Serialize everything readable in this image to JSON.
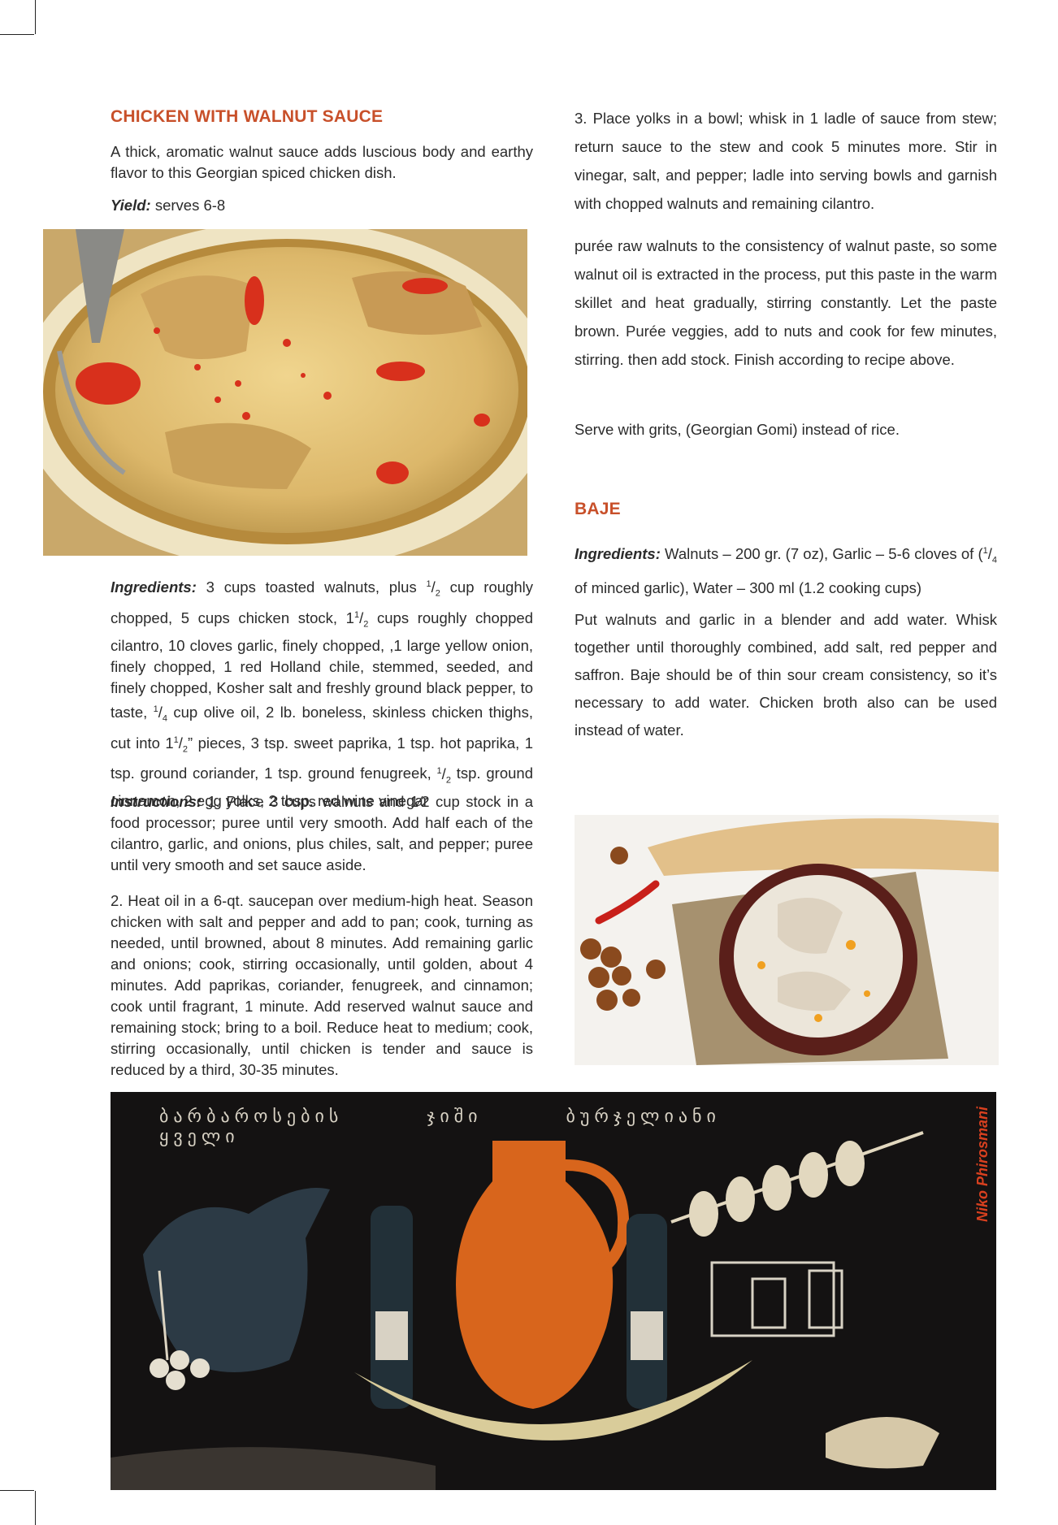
{
  "recipe1": {
    "title": "CHICKEN WITH WALNUT SAUCE",
    "intro": "A thick, aromatic walnut sauce adds luscious body and earthy flavor to this Georgian spiced chicken dish.",
    "yield_label": "Yield:",
    "yield_value": " serves 6-8",
    "ingredients_label": "Ingredients:",
    "ingredients": [
      " 3 cups toasted walnuts, plus ",
      {
        "num": "1",
        "den": "2"
      },
      " cup roughly chopped, 5 cups chicken stock, 1",
      {
        "num": "1",
        "den": "2"
      },
      " cups roughly chopped cilantro, 10 cloves garlic, finely chopped, ,1 large yellow onion, finely chopped, 1 red Holland chile, stemmed, seeded, and finely chopped, Kosher salt and freshly ground black pepper, to taste, ",
      {
        "num": "1",
        "den": "4"
      },
      " cup olive oil, 2 lb. boneless, skinless chicken thighs, cut into 1",
      {
        "num": "1",
        "den": "2"
      },
      "” pieces, 3 tsp. sweet paprika, 1 tsp. hot paprika, 1 tsp. ground coriander, 1 tsp. ground fenugreek, ",
      {
        "num": "1",
        "den": "2"
      },
      " tsp. ground cinnamon, 2 egg yolks, 2 tbsp. red wine vinegar"
    ],
    "instructions_label": "Instructions:",
    "step1": " 1. Place 3 cups walnuts and 1⁄2 cup stock in a food processor; puree until very smooth. Add half each of the cilantro, garlic, and onions, plus chiles, salt, and pepper; puree until very smooth and set sauce aside.",
    "step2": "2. Heat oil in a 6-qt. saucepan over medium-high heat. Season chicken with salt and pepper and add to pan; cook, turning as needed, until browned, about 8 minutes. Add remaining garlic and onions; cook, stirring occasionally, until golden, about 4 minutes. Add paprikas, coriander, fenugreek, and cinnamon; cook until fragrant, 1 minute. Add reserved walnut sauce and remaining stock; bring to a boil. Reduce heat to medium; cook, stirring occasionally, until chicken is tender and sauce is reduced by a third, 30-35 minutes.",
    "step3": "3. Place yolks in a bowl; whisk in 1 ladle of sauce from stew; return sauce to the stew and cook 5 minutes more. Stir in vinegar, salt, and pepper; ladle into serving bowls and garnish with chopped walnuts and remaining cilantro.",
    "tip": "purée raw walnuts to the consistency of walnut paste, so some walnut oil is extracted in the process, put this paste in the warm skillet and heat gradually, stirring constantly. Let the paste brown. Purée veggies, add to nuts and cook for few minutes, stirring. then add stock. Finish according to recipe above.",
    "serve": "Serve with grits, (Georgian Gomi) instead of rice."
  },
  "recipe2": {
    "title": "BAJE",
    "ingredients_label": "Ingredients:",
    "ingredients_a": " Walnuts – 200 gr. (7 oz), Garlic – 5-6 cloves of (",
    "ingredients_frac": {
      "num": "1",
      "den": "4"
    },
    "ingredients_b": " of minced garlic), Water – 300 ml (1.2 cooking cups)",
    "method": "Put walnuts and garlic in a blender and add water. Whisk together until thoroughly combined, add salt, red pepper and saffron. Baje should be of thin sour cream consistency, so it’s necessary to add water. Chicken broth also can be used instead of water."
  },
  "painting": {
    "credit": "Niko Phirosmani",
    "inscription": "ბარბაროსების ჯიში ბურჯელიანი ყველი"
  },
  "colors": {
    "heading": "#c8502a",
    "text": "#2b2b2b",
    "signature": "#d8401f"
  }
}
